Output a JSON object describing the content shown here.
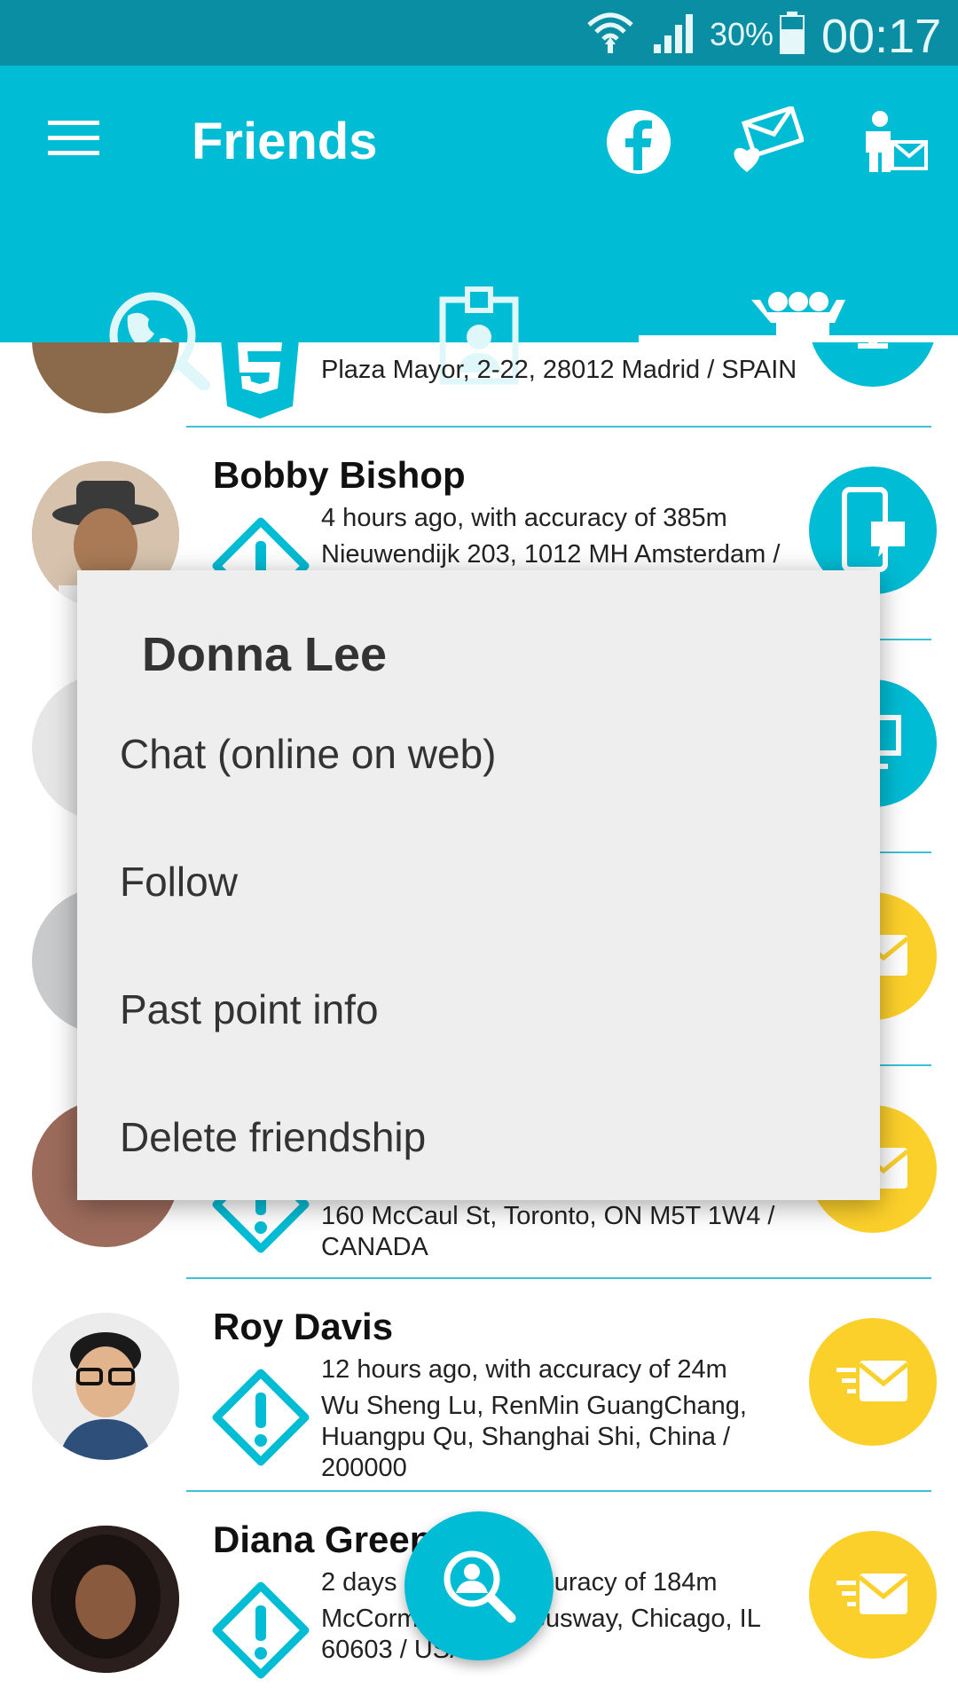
{
  "status_bar": {
    "battery": "30%",
    "time": "00:17"
  },
  "app_bar": {
    "title": "Friends",
    "actions": [
      "facebook-icon",
      "love-mail-icon",
      "invite-friend-icon"
    ],
    "tabs": [
      "world-search-icon",
      "badge-id-icon",
      "friends-group-icon"
    ],
    "selected_tab": 2
  },
  "friends": [
    {
      "name": "",
      "line1": "",
      "address": "Plaza Mayor, 2-22, 28012 Madrid / SPAIN",
      "status_icon": "html5-icon",
      "action": "computer-icon",
      "action_color": "#00bcd4"
    },
    {
      "name": "Bobby Bishop",
      "line1": "4 hours ago, with accuracy of 385m",
      "address": "Nieuwendijk 203, 1012 MH Amsterdam /",
      "status_icon": "warning-icon",
      "action": "mobile-chat-icon",
      "action_color": "#00bcd4"
    },
    {
      "name": "",
      "line1": "",
      "address": "",
      "status_icon": "",
      "action": "computer-icon",
      "action_color": "#00bcd4"
    },
    {
      "name": "",
      "line1": "",
      "address": "",
      "status_icon": "",
      "action": "send-mail-icon",
      "action_color": "#fcd02b"
    },
    {
      "name": "",
      "line1": "",
      "address": "160 McCaul St, Toronto, ON M5T 1W4 / CANADA",
      "status_icon": "warning-icon",
      "action": "send-mail-icon",
      "action_color": "#fcd02b"
    },
    {
      "name": "Roy Davis",
      "line1": "12 hours ago, with accuracy of 24m",
      "address": "Wu Sheng Lu, RenMin GuangChang, Huangpu Qu, Shanghai Shi, China / 200000",
      "status_icon": "warning-icon",
      "action": "send-mail-icon",
      "action_color": "#fcd02b"
    },
    {
      "name": "Diana Green",
      "line1": "2 days ago, with accuracy of 184m",
      "address": "McCormick Place Busway, Chicago, IL 60603 / USA",
      "status_icon": "warning-icon",
      "action": "send-mail-icon",
      "action_color": "#fcd02b"
    }
  ],
  "context_menu": {
    "title": "Donna Lee",
    "items": [
      "Chat (online on web)",
      "Follow",
      "Past point info",
      "Delete friendship"
    ]
  },
  "fab": {
    "icon": "search-user-icon"
  }
}
